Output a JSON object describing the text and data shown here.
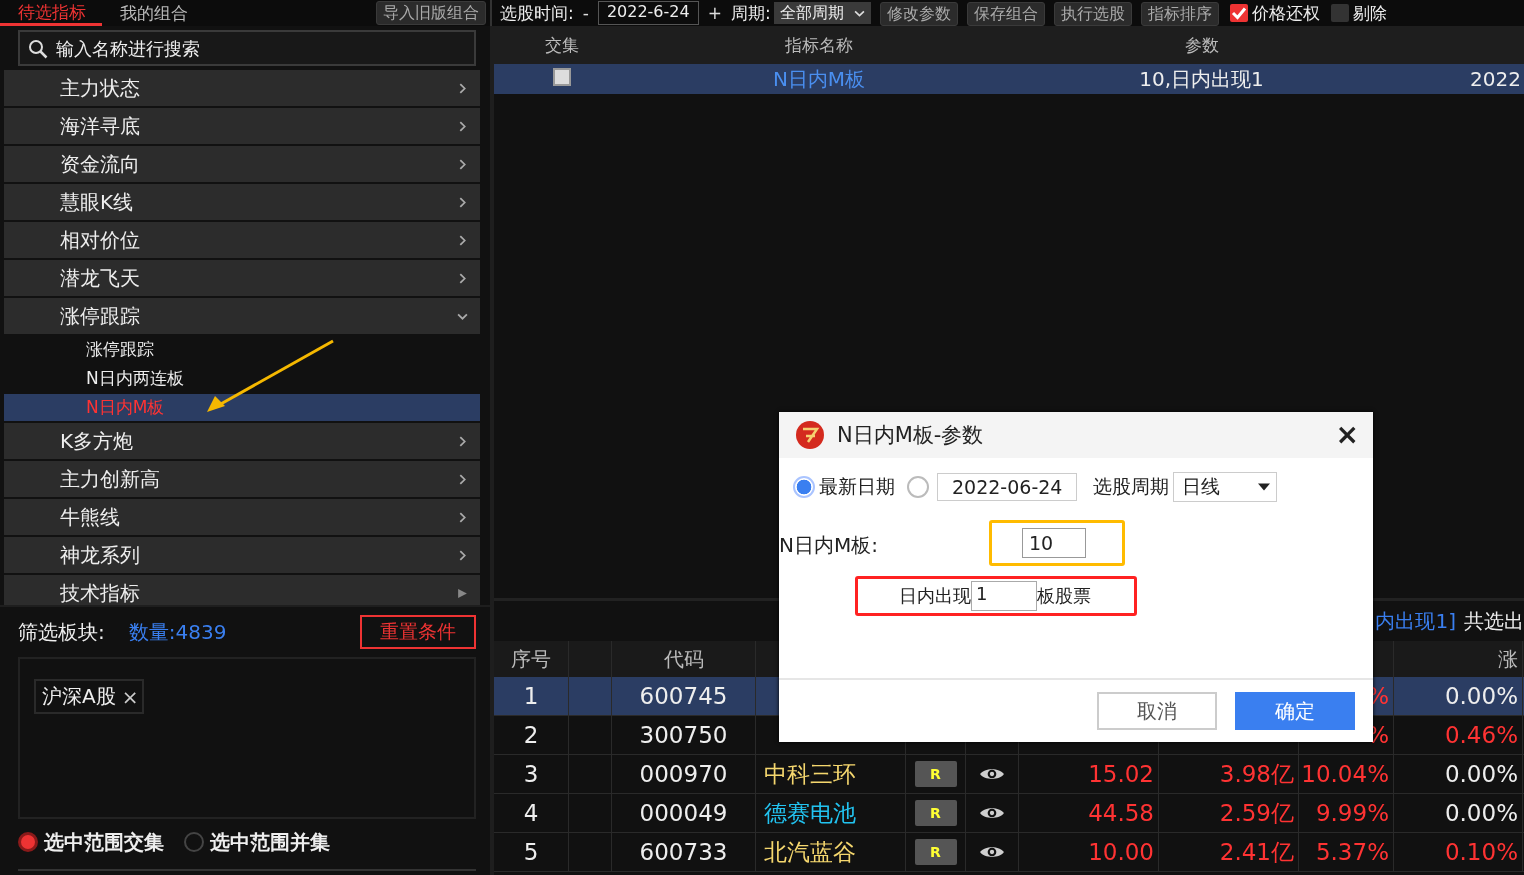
{
  "top_tabs": [
    {
      "label": "待选指标",
      "selected": true
    },
    {
      "label": "我的组合",
      "selected": false
    }
  ],
  "import_button": "导入旧版组合",
  "toolbar": {
    "date_label": "选股时间:",
    "minus": "-",
    "date": "2022-6-24",
    "plus": "+",
    "period_label": "周期:",
    "period": "全部周期",
    "buttons": [
      "修改参数",
      "保存组合",
      "执行选股",
      "指标排序"
    ],
    "checks": [
      {
        "label": "价格还权",
        "checked": true
      },
      {
        "label": "剔除",
        "checked": false
      }
    ]
  },
  "search": {
    "placeholder": "输入名称进行搜索"
  },
  "menu": [
    {
      "label": "主力状态",
      "kind": "folder",
      "expanded": false
    },
    {
      "label": "海洋寻底",
      "kind": "folder",
      "expanded": false
    },
    {
      "label": "资金流向",
      "kind": "folder",
      "expanded": false
    },
    {
      "label": "慧眼K线",
      "kind": "folder",
      "expanded": false
    },
    {
      "label": "相对价位",
      "kind": "folder",
      "expanded": false
    },
    {
      "label": "潜龙飞天",
      "kind": "folder",
      "expanded": false
    },
    {
      "label": "涨停跟踪",
      "kind": "folder",
      "expanded": true,
      "children": [
        {
          "label": "涨停跟踪",
          "selected": false
        },
        {
          "label": "N日内两连板",
          "selected": false
        },
        {
          "label": "N日内M板",
          "selected": true
        }
      ]
    },
    {
      "label": "K多方炮",
      "kind": "folder",
      "expanded": false
    },
    {
      "label": "主力创新高",
      "kind": "folder",
      "expanded": false
    },
    {
      "label": "牛熊线",
      "kind": "folder",
      "expanded": false
    },
    {
      "label": "神龙系列",
      "kind": "folder",
      "expanded": false
    },
    {
      "label": "技术指标",
      "kind": "section"
    }
  ],
  "filter": {
    "label": "筛选板块:",
    "count": "数量:4839",
    "reset": "重置条件",
    "tags": [
      "沪深A股"
    ],
    "tag_close": "×",
    "modes": [
      {
        "label": "选中范围交集",
        "selected": true
      },
      {
        "label": "选中范围并集",
        "selected": false
      }
    ]
  },
  "indicator_table": {
    "columns": [
      "交集",
      "指标名称",
      "参数"
    ],
    "rows": [
      {
        "checked": false,
        "name": "N日内M板",
        "params": "10,日内出现1",
        "column_4": "2022",
        "selected": true
      }
    ]
  },
  "result_status": {
    "condition": "内出现1]",
    "summary": "共选出"
  },
  "stock_table": {
    "columns": [
      "序号",
      "代码",
      "涨"
    ],
    "rows": [
      {
        "seq": "1",
        "code": "600745",
        "pct": "%",
        "change": "0.00%",
        "up": false,
        "selected": true
      },
      {
        "seq": "2",
        "code": "300750",
        "pct": "%",
        "change": "0.46%",
        "up": true,
        "selected": false
      },
      {
        "seq": "3",
        "code": "000970",
        "name": "中科三环",
        "color": "#f5d76e",
        "badge": "R",
        "price": "15.02",
        "amount": "3.98亿",
        "pct": "10.04%",
        "change": "0.00%",
        "up": false,
        "selected": false
      },
      {
        "seq": "4",
        "code": "000049",
        "name": "德赛电池",
        "color": "#22c3f0",
        "badge": "R",
        "price": "44.58",
        "amount": "2.59亿",
        "pct": "9.99%",
        "change": "0.00%",
        "up": false,
        "selected": false
      },
      {
        "seq": "5",
        "code": "600733",
        "name": "北汽蓝谷",
        "color": "#f5d76e",
        "badge": "R",
        "price": "10.00",
        "amount": "2.41亿",
        "pct": "5.37%",
        "change": "0.10%",
        "up": true,
        "selected": false
      }
    ]
  },
  "dialog": {
    "title": "N日内M板-参数",
    "close": "×",
    "radios": [
      {
        "label": "最新日期",
        "selected": true
      },
      {
        "date": "2022-06-24",
        "selected": false
      }
    ],
    "period_label": "选股周期",
    "period": "日线",
    "param_label": "N日内M板:",
    "n_value": "10",
    "m_prefix": "日内出现",
    "m_value": "1",
    "m_suffix": "板股票",
    "buttons": [
      {
        "label": "取消",
        "kind": "cancel"
      },
      {
        "label": "确定",
        "kind": "ok"
      }
    ]
  }
}
